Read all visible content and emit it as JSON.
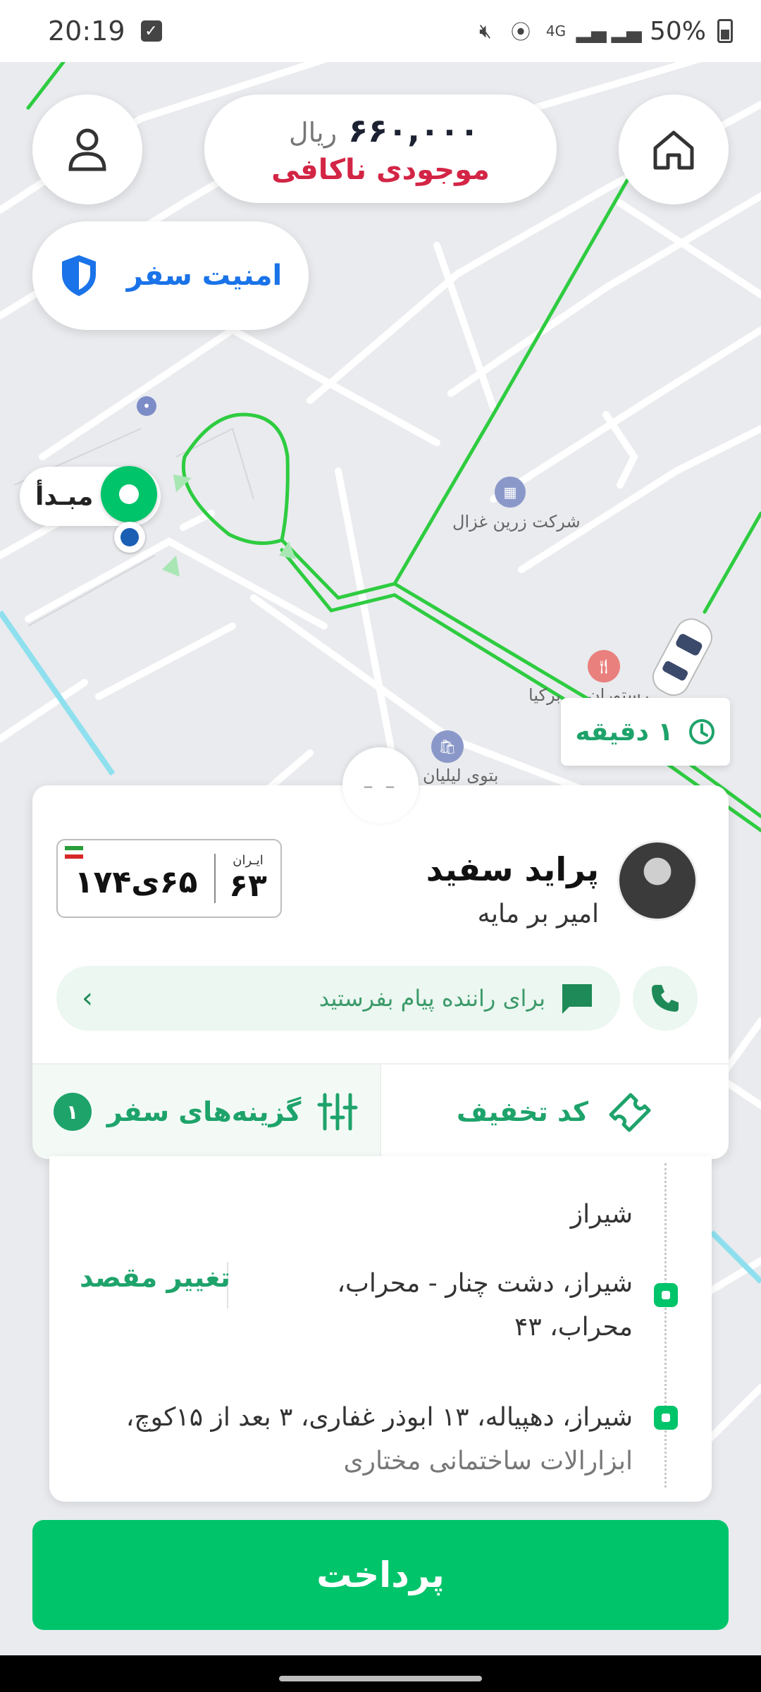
{
  "status_bar": {
    "time": "20:19",
    "battery": "50%"
  },
  "balance": {
    "amount": "۶۶۰,۰۰۰",
    "currency": "ریال",
    "status": "موجودی ناکافی"
  },
  "safety": {
    "label": "امنیت سفر"
  },
  "origin": {
    "label": "مبـدأ"
  },
  "map_labels": {
    "poi_company": "شرکت زرین غزال",
    "poi_restaurant": "رستوران ... برکیا",
    "poi_shop": "بتوی لیلیان"
  },
  "eta": {
    "label": "۱ دقیقه"
  },
  "sheet_handle": {
    "label": "– –"
  },
  "driver": {
    "car": "پراید سفید",
    "name": "امیر بر مایه",
    "plate": {
      "number": "۶۵ی۱۷۴",
      "region_label": "ایـران",
      "region_code": "۶۳"
    },
    "message_placeholder": "برای راننده پیام بفرستید"
  },
  "footer": {
    "discount_label": "کد تخفیف",
    "options_label": "گزینه‌های سفر",
    "options_count": "۱"
  },
  "addresses": {
    "origin_tail": "شیراز",
    "destination_1_line1": "شیراز، دشت چنار - محراب،",
    "destination_1_line2": "محراب، ۴۳",
    "change_destination": "تغییر مقصد",
    "destination_2_line1": "شیراز، دهپیاله، ۱۳ ابوذر غفاری، ۳ بعد از ۱۵کوچ،",
    "destination_2_line2": "ابزارالات ساختمانی مختاری"
  },
  "pay_button": {
    "label": "پرداخت"
  },
  "colors": {
    "accent_green": "#00c46a",
    "text_green": "#1ea36b",
    "warning_red": "#d32545",
    "blue": "#1a73e8"
  }
}
